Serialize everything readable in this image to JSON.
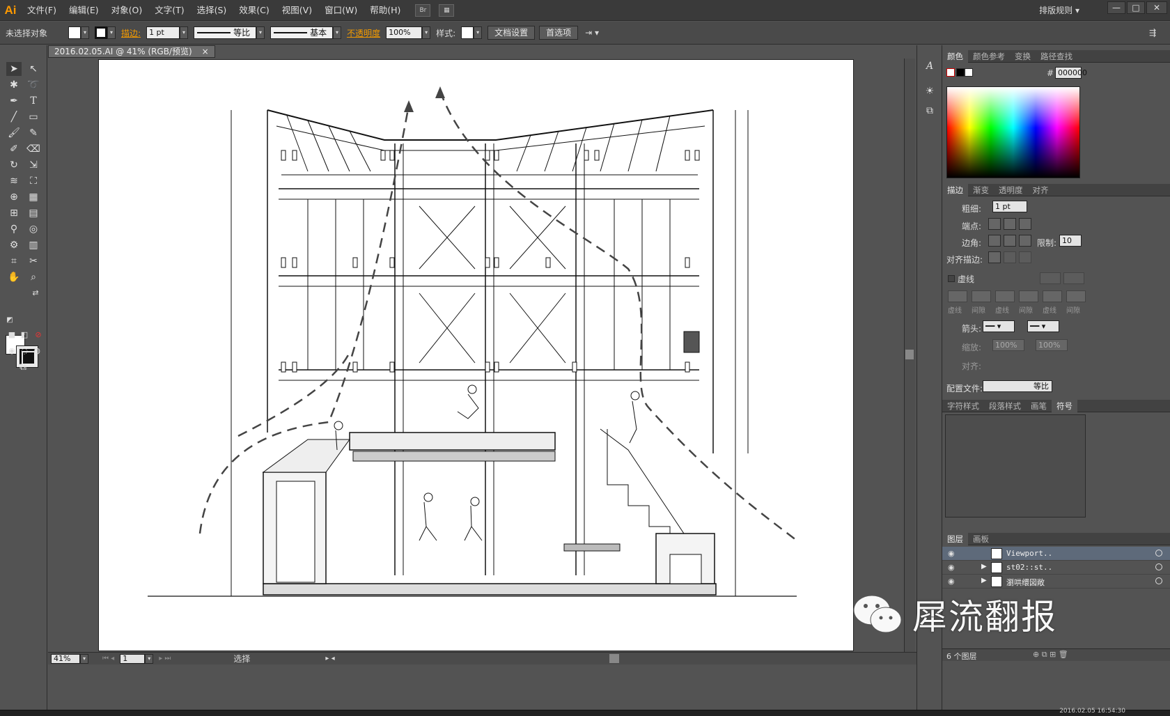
{
  "app": {
    "logo": "Ai",
    "menu": [
      "文件(F)",
      "编辑(E)",
      "对象(O)",
      "文字(T)",
      "选择(S)",
      "效果(C)",
      "视图(V)",
      "窗口(W)",
      "帮助(H)"
    ],
    "bridge_button": "Br",
    "workspace": "排版规则",
    "window_buttons": [
      "—",
      "□",
      "✕"
    ]
  },
  "controlbar": {
    "selection_status": "未选择对象",
    "stroke_label": "描边:",
    "stroke_weight": "1 pt",
    "profile_label": "等比",
    "brush_label": "基本",
    "opacity_label": "不透明度",
    "opacity_value": "100%",
    "style_label": "样式:",
    "doc_setup_button": "文档设置",
    "preferences_button": "首选项"
  },
  "document": {
    "tab_title": "2016.02.05.AI @ 41% (RGB/预览)",
    "tab_close": "×",
    "zoom": "41%",
    "artboard_number": "1",
    "status_tool": "选择"
  },
  "panels": {
    "color_tabs": [
      "颜色",
      "颜色参考",
      "变换",
      "路径查找"
    ],
    "hex_value": "000000",
    "stroke_tabs": [
      "描边",
      "渐变",
      "透明度",
      "对齐"
    ],
    "weight_label": "粗细:",
    "weight_value": "1 pt",
    "cap_label": "端点:",
    "corner_label": "边角:",
    "limit_label": "限制:",
    "limit_value": "10",
    "align_stroke_label": "对齐描边:",
    "dashed_label": "虚线",
    "dash_labels": [
      "虚线",
      "间隙",
      "虚线",
      "间隙",
      "虚线",
      "间隙"
    ],
    "arrow_label": "箭头:",
    "scale_label": "缩放:",
    "scale_value_1": "100%",
    "scale_value_2": "100%",
    "align_label": "对齐:",
    "profile_label": "配置文件:",
    "profile_value": "等比",
    "symbol_tabs": [
      "字符样式",
      "段落样式",
      "画笔",
      "符号"
    ],
    "layer_tabs": [
      "图层",
      "画板"
    ],
    "layers": [
      "Viewport..",
      "st02::st..",
      "瀏哄缳図敞"
    ],
    "layers_count": "6 个图层"
  },
  "taskbar": {
    "clock": "2016.02.05 16:54:30"
  },
  "watermark": {
    "text": "犀流翻报"
  }
}
